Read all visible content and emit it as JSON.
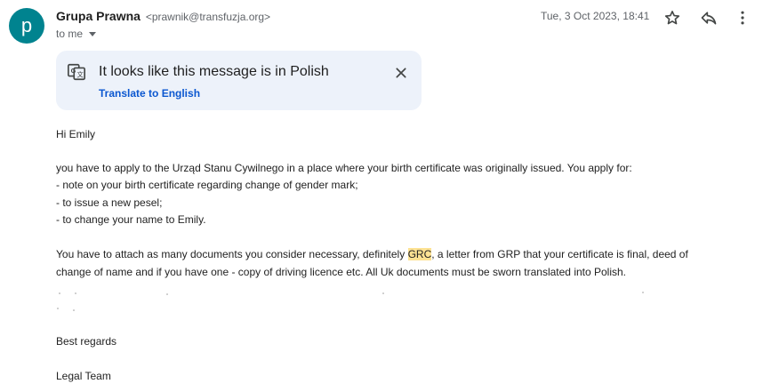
{
  "sender": {
    "avatar_letter": "p",
    "name": "Grupa Prawna",
    "email": "<prawnik@transfuzja.org>",
    "to": "to me"
  },
  "header": {
    "date": "Tue, 3 Oct 2023, 18:41",
    "icons": [
      "star-icon",
      "reply-icon",
      "more-vert-icon"
    ]
  },
  "translate": {
    "icon": "translate-icon",
    "title": "It looks like this message is in Polish",
    "link": "Translate to English",
    "close_icon": "close-icon"
  },
  "message": {
    "greeting": "Hi Emily",
    "para1": {
      "intro": "you have to apply to the Urząd Stanu Cywilnego in a place where your birth certificate was originally issued.  You apply for:",
      "items": [
        "- note on your birth certificate regarding change of gender mark;",
        "- to issue a new pesel;",
        "- to change your name to Emily."
      ]
    },
    "para2": {
      "line1_before": "You have to attach as many documents you consider necessary, definitely ",
      "line1_highlight": "GRC",
      "line1_after": ", a letter from GRP that your certificate is final, deed of",
      "line2": "change of name and if you have one - copy of driving licence etc.  All Uk documents must be sworn translated into Polish."
    },
    "closing": "Best regards",
    "signature": "Legal Team"
  },
  "colors": {
    "avatar_bg": "#00838f",
    "translate_bg": "#edf2fa",
    "link": "#0b57d0",
    "highlight": "#fde293"
  }
}
